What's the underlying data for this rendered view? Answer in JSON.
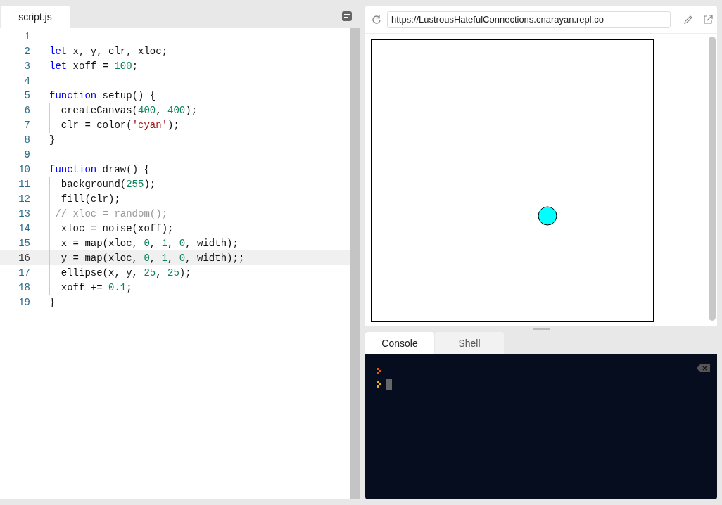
{
  "editor": {
    "tab": {
      "label": "script.js",
      "selected": true
    },
    "lines": [
      {
        "number": "1",
        "selected": false
      },
      {
        "number": "2",
        "selected": false,
        "tokens": [
          {
            "kind": "kw",
            "text": "let"
          },
          {
            "kind": "plain",
            "text": " x, y, clr, xloc;"
          }
        ]
      },
      {
        "number": "3",
        "selected": false,
        "tokens": [
          {
            "kind": "kw",
            "text": "let"
          },
          {
            "kind": "plain",
            "text": " xoff = "
          },
          {
            "kind": "num",
            "text": "100"
          },
          {
            "kind": "plain",
            "text": ";"
          }
        ]
      },
      {
        "number": "4",
        "selected": false
      },
      {
        "number": "5",
        "selected": false,
        "tokens": [
          {
            "kind": "kw",
            "text": "function"
          },
          {
            "kind": "plain",
            "text": " setup() {"
          }
        ]
      },
      {
        "number": "6",
        "selected": false,
        "tokens": [
          {
            "kind": "plain",
            "text": "  createCanvas("
          },
          {
            "kind": "num",
            "text": "400"
          },
          {
            "kind": "plain",
            "text": ", "
          },
          {
            "kind": "num",
            "text": "400"
          },
          {
            "kind": "plain",
            "text": ");"
          }
        ]
      },
      {
        "number": "7",
        "selected": false,
        "tokens": [
          {
            "kind": "plain",
            "text": "  clr = color("
          },
          {
            "kind": "str",
            "text": "'cyan'"
          },
          {
            "kind": "plain",
            "text": ");"
          }
        ]
      },
      {
        "number": "8",
        "selected": false,
        "tokens": [
          {
            "kind": "plain",
            "text": "}"
          }
        ]
      },
      {
        "number": "9",
        "selected": false
      },
      {
        "number": "10",
        "selected": false,
        "tokens": [
          {
            "kind": "kw",
            "text": "function"
          },
          {
            "kind": "plain",
            "text": " draw() {"
          }
        ]
      },
      {
        "number": "11",
        "selected": false,
        "tokens": [
          {
            "kind": "plain",
            "text": "  background("
          },
          {
            "kind": "num",
            "text": "255"
          },
          {
            "kind": "plain",
            "text": ");"
          }
        ]
      },
      {
        "number": "12",
        "selected": false,
        "tokens": [
          {
            "kind": "plain",
            "text": "  fill(clr);"
          }
        ]
      },
      {
        "number": "13",
        "selected": false,
        "tokens": [
          {
            "kind": "com",
            "text": " // xloc = random();"
          }
        ]
      },
      {
        "number": "14",
        "selected": false,
        "tokens": [
          {
            "kind": "plain",
            "text": "  xloc = noise(xoff);"
          }
        ]
      },
      {
        "number": "15",
        "selected": false,
        "tokens": [
          {
            "kind": "plain",
            "text": "  x = map(xloc, "
          },
          {
            "kind": "num",
            "text": "0"
          },
          {
            "kind": "plain",
            "text": ", "
          },
          {
            "kind": "num",
            "text": "1"
          },
          {
            "kind": "plain",
            "text": ", "
          },
          {
            "kind": "num",
            "text": "0"
          },
          {
            "kind": "plain",
            "text": ", width);"
          }
        ]
      },
      {
        "number": "16",
        "selected": true,
        "tokens": [
          {
            "kind": "plain",
            "text": "  y = map(xloc, "
          },
          {
            "kind": "num",
            "text": "0"
          },
          {
            "kind": "plain",
            "text": ", "
          },
          {
            "kind": "num",
            "text": "1"
          },
          {
            "kind": "plain",
            "text": ", "
          },
          {
            "kind": "num",
            "text": "0"
          },
          {
            "kind": "plain",
            "text": ", width);;"
          }
        ]
      },
      {
        "number": "17",
        "selected": false,
        "tokens": [
          {
            "kind": "plain",
            "text": "  ellipse(x, y, "
          },
          {
            "kind": "num",
            "text": "25"
          },
          {
            "kind": "plain",
            "text": ", "
          },
          {
            "kind": "num",
            "text": "25"
          },
          {
            "kind": "plain",
            "text": ");"
          }
        ]
      },
      {
        "number": "18",
        "selected": false,
        "tokens": [
          {
            "kind": "plain",
            "text": "  xoff += "
          },
          {
            "kind": "num",
            "text": "0.1"
          },
          {
            "kind": "plain",
            "text": ";"
          }
        ]
      },
      {
        "number": "19",
        "selected": false,
        "tokens": [
          {
            "kind": "plain",
            "text": "}"
          }
        ]
      }
    ]
  },
  "browser": {
    "url": "https://LustrousHatefulConnections.cnarayan.repl.co"
  },
  "console": {
    "tabs": [
      {
        "label": "Console",
        "selected": true
      },
      {
        "label": "Shell",
        "selected": false
      }
    ]
  }
}
